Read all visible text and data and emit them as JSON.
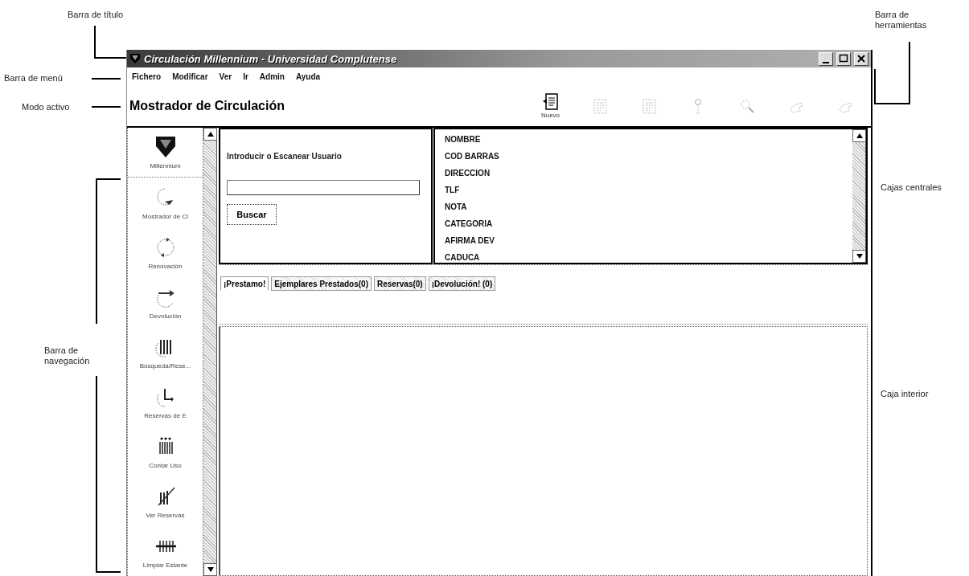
{
  "annotations": [
    {
      "text": "Barra de título"
    },
    {
      "text": "Barra de menú"
    },
    {
      "text": "Modo activo"
    },
    {
      "text": "Barra de navegación"
    },
    {
      "text": "Barra de herramientas"
    },
    {
      "text": "Cajas centrales"
    },
    {
      "text": "Caja interior"
    }
  ],
  "window": {
    "title": "Circulación Millennium - Universidad Complutense"
  },
  "menu": [
    "Fichero",
    "Modificar",
    "Ver",
    "Ir",
    "Admin",
    "Ayuda"
  ],
  "mode": "Mostrador de Circulación",
  "toolbar": [
    {
      "kind": "new",
      "label": "Nuevo",
      "disabled": false
    },
    {
      "kind": "doc",
      "disabled": true
    },
    {
      "kind": "doc",
      "disabled": true
    },
    {
      "kind": "pin",
      "disabled": true
    },
    {
      "kind": "search",
      "disabled": true
    },
    {
      "kind": "hand",
      "disabled": true
    },
    {
      "kind": "hand",
      "disabled": true
    }
  ],
  "sidebar": {
    "items": [
      {
        "kind": "logo",
        "label": "Millennium"
      },
      {
        "kind": "arrow",
        "label": "Mostrador de Ci"
      },
      {
        "kind": "cycle",
        "label": "Renovación"
      },
      {
        "kind": "return",
        "label": "Devolución"
      },
      {
        "kind": "bars",
        "label": "Búsqueda/Rese..."
      },
      {
        "kind": "corner",
        "label": "Reservas de E"
      },
      {
        "kind": "dots",
        "label": "Contar Uso"
      },
      {
        "kind": "chart",
        "label": "Ver Reservas"
      },
      {
        "kind": "strike",
        "label": "Limpiar Estante"
      }
    ]
  },
  "search": {
    "label": "Introducir o Escanear Usuario",
    "button": "Buscar"
  },
  "fields": [
    "NOMBRE",
    "COD BARRAS",
    "DIRECCION",
    "TLF",
    "NOTA",
    "CATEGORIA",
    "AFIRMA DEV",
    "CADUCA"
  ],
  "tabs": [
    {
      "label": "¡Prestamo!",
      "selected": true
    },
    {
      "label": "Ejemplares Prestados(0)",
      "selected": false
    },
    {
      "label": "Reservas(0)",
      "selected": false
    },
    {
      "label": "¡Devolución! (0)",
      "selected": false
    }
  ]
}
